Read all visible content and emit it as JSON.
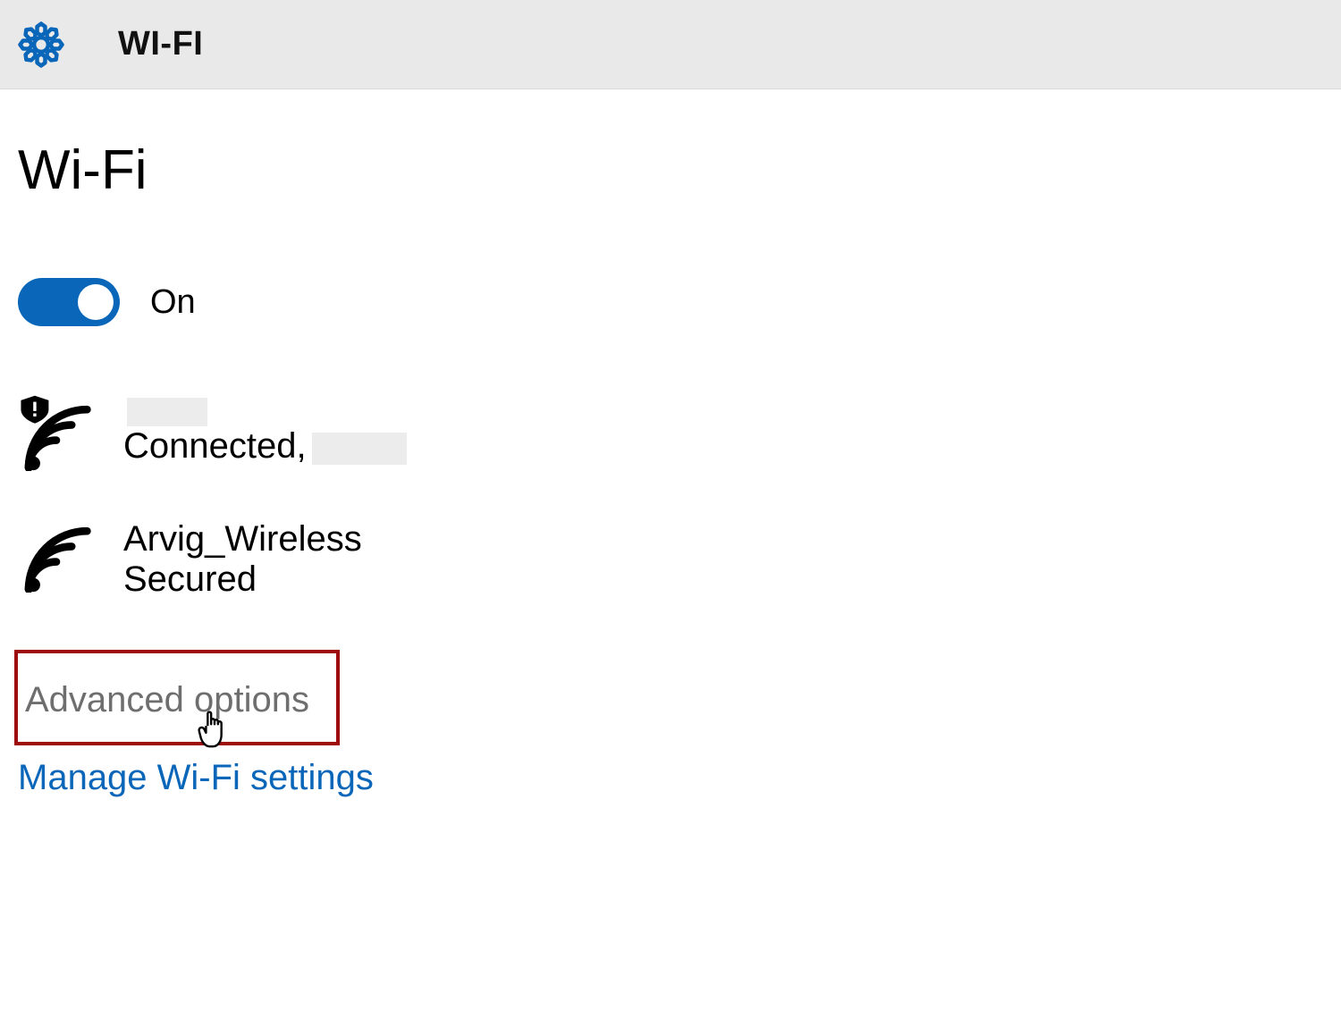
{
  "header": {
    "title": "WI-FI"
  },
  "page": {
    "title": "Wi-Fi"
  },
  "toggle": {
    "state_label": "On",
    "on": true
  },
  "networks": [
    {
      "name": "",
      "status": "Connected,",
      "name_redacted": true,
      "status_extra_redacted": true,
      "alert": true
    },
    {
      "name": "Arvig_Wireless",
      "status": "Secured",
      "alert": false
    }
  ],
  "links": {
    "advanced": "Advanced options",
    "manage": "Manage Wi-Fi settings"
  },
  "colors": {
    "accent": "#0a66b8",
    "header_bg": "#e9e9e9",
    "highlight_box": "#9d0b0e",
    "link": "#0a66b8"
  }
}
